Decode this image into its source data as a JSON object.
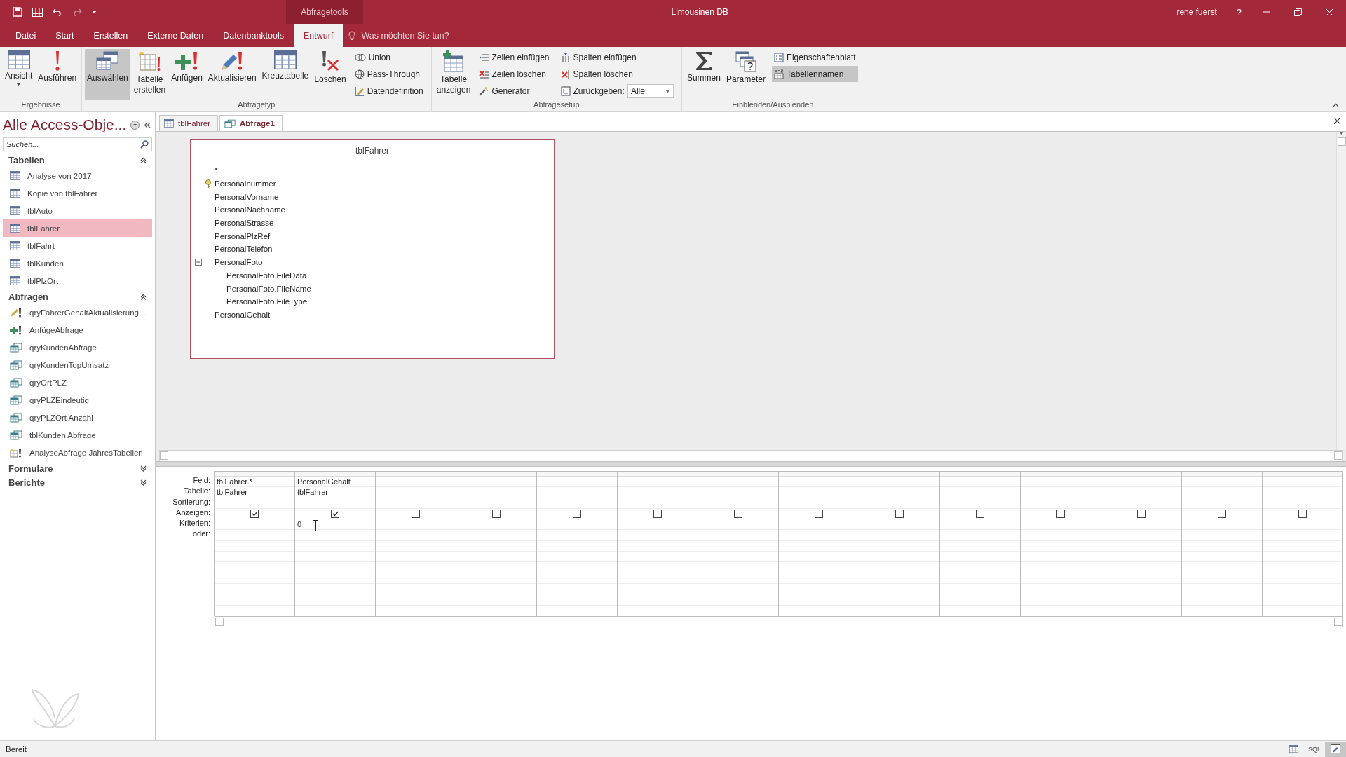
{
  "window": {
    "context_tab": "Abfragetools",
    "title": "Limousinen DB",
    "user": "rene fuerst",
    "help": "?"
  },
  "menu_tabs": [
    {
      "label": "Datei",
      "selected": false
    },
    {
      "label": "Start",
      "selected": false
    },
    {
      "label": "Erstellen",
      "selected": false
    },
    {
      "label": "Externe Daten",
      "selected": false
    },
    {
      "label": "Datenbanktools",
      "selected": false
    },
    {
      "label": "Entwurf",
      "selected": true
    }
  ],
  "tell_me": {
    "placeholder": "Was möchten Sie tun?"
  },
  "ribbon_groups": [
    {
      "label": "Ergebnisse",
      "items": [
        {
          "kind": "large",
          "label": "Ansicht",
          "dropdown": true,
          "selected": false
        },
        {
          "kind": "large",
          "label": "Ausführen",
          "selected": false
        }
      ]
    },
    {
      "label": "Abfragetyp",
      "items": [
        {
          "kind": "large",
          "label": "Auswählen",
          "selected": true
        },
        {
          "kind": "large",
          "label": "Tabelle\nerstellen",
          "selected": false
        },
        {
          "kind": "large",
          "label": "Anfügen",
          "selected": false
        },
        {
          "kind": "large",
          "label": "Aktualisieren",
          "selected": false
        },
        {
          "kind": "large",
          "label": "Kreuztabelle",
          "selected": false
        },
        {
          "kind": "large",
          "label": "Löschen",
          "selected": false
        },
        {
          "kind": "small",
          "label": "Union",
          "selected": false
        },
        {
          "kind": "small",
          "label": "Pass-Through",
          "selected": false
        },
        {
          "kind": "small",
          "label": "Datendefinition",
          "selected": false
        }
      ]
    },
    {
      "label": "Abfragesetup",
      "items": [
        {
          "kind": "large",
          "label": "Tabelle\nanzeigen",
          "selected": false
        },
        {
          "kind": "small",
          "label": "Zeilen einfügen",
          "selected": false
        },
        {
          "kind": "small",
          "label": "Zeilen löschen",
          "selected": false
        },
        {
          "kind": "small",
          "label": "Generator",
          "selected": false
        },
        {
          "kind": "small",
          "label": "Spalten einfügen",
          "selected": false
        },
        {
          "kind": "small",
          "label": "Spalten löschen",
          "selected": false
        },
        {
          "kind": "combo",
          "label": "Zurückgeben:",
          "value": "Alle",
          "selected": false
        }
      ]
    },
    {
      "label": "Einblenden/Ausblenden",
      "items": [
        {
          "kind": "large",
          "label": "Summen",
          "selected": false
        },
        {
          "kind": "large",
          "label": "Parameter",
          "selected": false
        },
        {
          "kind": "small",
          "label": "Eigenschaftenblatt",
          "selected": false
        },
        {
          "kind": "small",
          "label": "Tabellennamen",
          "selected": true
        }
      ]
    }
  ],
  "navigation": {
    "title": "Alle Access-Obje...",
    "search": {
      "placeholder": "Suchen..."
    },
    "sections": [
      {
        "title": "Tabellen",
        "expanded": true,
        "items": [
          {
            "label": "Analyse von 2017",
            "kind": "table",
            "selected": false
          },
          {
            "label": "Kopie von tblFahrer",
            "kind": "table",
            "selected": false
          },
          {
            "label": "tblAuto",
            "kind": "table",
            "selected": false
          },
          {
            "label": "tblFahrer",
            "kind": "table",
            "selected": true
          },
          {
            "label": "tblFahrt",
            "kind": "table",
            "selected": false
          },
          {
            "label": "tblKunden",
            "kind": "table",
            "selected": false
          },
          {
            "label": "tblPlzOrt",
            "kind": "table",
            "selected": false
          }
        ]
      },
      {
        "title": "Abfragen",
        "expanded": true,
        "items": [
          {
            "label": "qryFahrerGehaltAktualisierung...",
            "kind": "update",
            "selected": false
          },
          {
            "label": "AnfügeAbfrage",
            "kind": "append",
            "selected": false
          },
          {
            "label": "qryKundenAbfrage",
            "kind": "select",
            "selected": false
          },
          {
            "label": "qryKundenTopUmsatz",
            "kind": "select",
            "selected": false
          },
          {
            "label": "qryOrtPLZ",
            "kind": "select",
            "selected": false
          },
          {
            "label": "qryPLZEindeutig",
            "kind": "select",
            "selected": false
          },
          {
            "label": "qryPLZOrt Anzahl",
            "kind": "select",
            "selected": false
          },
          {
            "label": "tblKunden Abfrage",
            "kind": "select",
            "selected": false
          },
          {
            "label": "AnalyseAbfrage JahresTabellen",
            "kind": "maketable",
            "selected": false
          }
        ]
      },
      {
        "title": "Formulare",
        "expanded": false
      },
      {
        "title": "Berichte",
        "expanded": false
      }
    ]
  },
  "document_tabs": [
    {
      "label": "tblFahrer",
      "kind": "table",
      "selected": false
    },
    {
      "label": "Abfrage1",
      "kind": "query",
      "selected": true
    }
  ],
  "field_list": {
    "title": "tblFahrer",
    "fields": [
      {
        "name": "*",
        "key": false
      },
      {
        "name": "Personalnummer",
        "key": true
      },
      {
        "name": "PersonalVorname",
        "key": false
      },
      {
        "name": "PersonalNachname",
        "key": false
      },
      {
        "name": "PersonalStrasse",
        "key": false
      },
      {
        "name": "PersonalPlzRef",
        "key": false
      },
      {
        "name": "PersonalTelefon",
        "key": false
      },
      {
        "name": "PersonalFoto",
        "key": false,
        "expanded": true,
        "children": [
          {
            "name": "PersonalFoto.FileData"
          },
          {
            "name": "PersonalFoto.FileName"
          },
          {
            "name": "PersonalFoto.FileType"
          }
        ]
      },
      {
        "name": "PersonalGehalt",
        "key": false
      }
    ]
  },
  "design_grid": {
    "row_labels": [
      "Feld:",
      "Tabelle:",
      "Sortierung:",
      "Anzeigen:",
      "Kriterien:",
      "oder:"
    ],
    "columns": [
      {
        "field": "tblFahrer.*",
        "table": "tblFahrer",
        "show": true
      },
      {
        "field": "PersonalGehalt",
        "table": "tblFahrer",
        "show": true,
        "criteria": "0"
      },
      {
        "show": false
      },
      {
        "show": false
      },
      {
        "show": false
      },
      {
        "show": false
      },
      {
        "show": false
      },
      {
        "show": false
      },
      {
        "show": false
      },
      {
        "show": false
      },
      {
        "show": false
      },
      {
        "show": false
      },
      {
        "show": false
      },
      {
        "show": false
      }
    ]
  },
  "status_bar": {
    "text": "Bereit",
    "views": [
      {
        "kind": "datasheet",
        "selected": false
      },
      {
        "kind": "sql",
        "label": "SQL",
        "selected": false
      },
      {
        "kind": "design",
        "selected": true
      }
    ]
  }
}
